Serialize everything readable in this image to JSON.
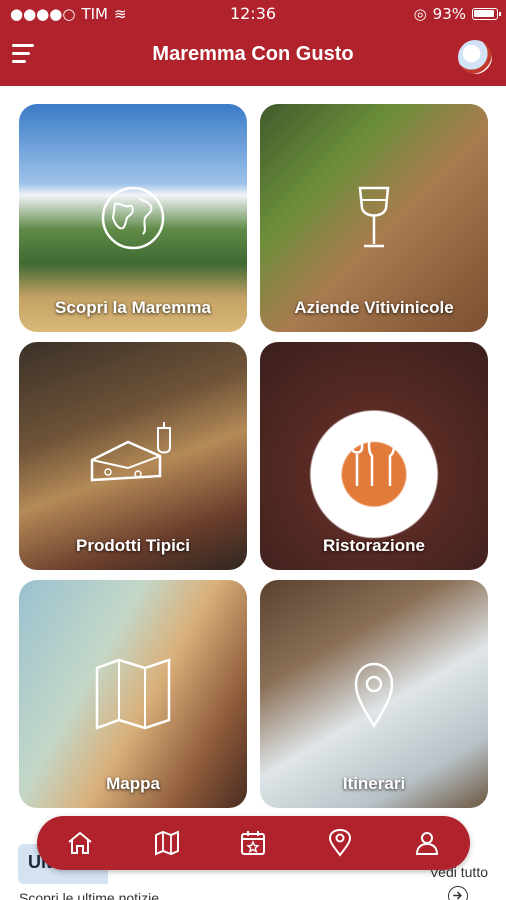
{
  "status_bar": {
    "carrier": "TIM",
    "time": "12:36",
    "battery": "93%"
  },
  "app_bar": {
    "title": "Maremma Con Gusto"
  },
  "tiles": [
    {
      "label": "Scopri la Maremma",
      "icon": "globe-icon"
    },
    {
      "label": "Aziende Vitivinicole",
      "icon": "wine-glass-icon"
    },
    {
      "label": "Prodotti Tipici",
      "icon": "cheese-icon"
    },
    {
      "label": "Ristorazione",
      "icon": "plate-cutlery-icon"
    },
    {
      "label": "Mappa",
      "icon": "map-icon"
    },
    {
      "label": "Itinerari",
      "icon": "location-pin-icon"
    }
  ],
  "news_section": {
    "title_partial": "Ult",
    "subtitle": "Scopri le ultime notizie",
    "see_all": "Vedi tutto"
  },
  "bottom_nav": [
    {
      "name": "home",
      "icon": "home-icon"
    },
    {
      "name": "map",
      "icon": "map-icon"
    },
    {
      "name": "events",
      "icon": "calendar-star-icon"
    },
    {
      "name": "places",
      "icon": "location-pin-icon"
    },
    {
      "name": "profile",
      "icon": "user-icon"
    }
  ],
  "colors": {
    "brand_red": "#b0222c",
    "white": "#ffffff"
  }
}
